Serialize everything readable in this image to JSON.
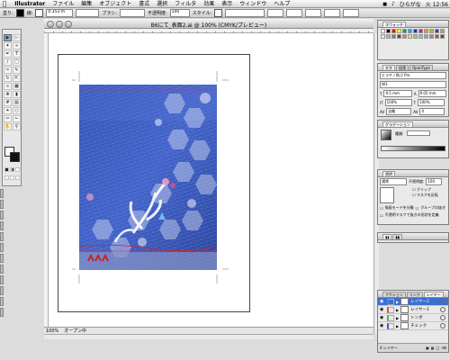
{
  "menubar": {
    "app": "Illustrator",
    "items": [
      "ファイル",
      "編集",
      "オブジェクト",
      "書式",
      "選択",
      "フィルタ",
      "効果",
      "表示",
      "ウィンドウ",
      "ヘルプ"
    ],
    "user": "ひらがな",
    "clock": "火 12:56"
  },
  "controlbar": {
    "fill_label": "塗り:",
    "stroke_label": "線:",
    "stroke_weight": "0.353 m",
    "brush_label": "ブラシ:",
    "opacity_label": "不透明度:",
    "opacity_value": "100",
    "style_label": "スタイル:"
  },
  "document": {
    "title": "B6にて_表面2.ai @ 100% (CMYK/プレビュー)",
    "zoom": "100%",
    "status_text": "オープン中"
  },
  "panels": {
    "swatches": {
      "tab": "スウォッチ",
      "colors": [
        "#ffffff",
        "#000000",
        "#ff0000",
        "#ffff00",
        "#00a651",
        "#00aeef",
        "#2e3192",
        "#ec008c",
        "#f7941d",
        "#8dc63f",
        "#662d91",
        "#c69c6d",
        "#e6e6e6",
        "#b3b3b3",
        "#808080",
        "#4d4d4d",
        "#ff6666",
        "#ffcc99",
        "#99cc66",
        "#66ccff",
        "#9999cc",
        "#cc6699",
        "#996633",
        "#336633"
      ]
    },
    "character": {
      "tabs": [
        "文字",
        "段落",
        "OpenType"
      ],
      "font": "ヒラギノ角ゴ Pro",
      "style": "W3",
      "size": "9.5 mm",
      "leading": "9.05 mm",
      "hscale": "100%",
      "vscale": "100%",
      "tracking": "自動",
      "kerning": "0"
    },
    "gradient": {
      "tab": "グラデーション",
      "type_label": "種類:"
    },
    "transparency": {
      "tab": "透明",
      "mode": "通常",
      "opacity_label": "不透明度:",
      "opacity_value": "100",
      "clip_label": "クリップ",
      "invert_label": "マスクを反転",
      "isolate_label": "描画モードを分離",
      "knockout_label": "グループの抜き",
      "mask_label": "不透明マスクで抜きの形状を定義"
    },
    "layers": {
      "tabs": [
        "レイヤー",
        "アクション",
        "リンク"
      ],
      "items": [
        {
          "name": "レイヤー2",
          "color": "#4a7ee0"
        },
        {
          "name": "レイヤー1",
          "color": "#e04a4a"
        },
        {
          "name": "トンボ",
          "color": "#4ac04a"
        },
        {
          "name": "チェック",
          "color": "#4a4ae0"
        }
      ],
      "count": "4 レイヤー"
    }
  }
}
